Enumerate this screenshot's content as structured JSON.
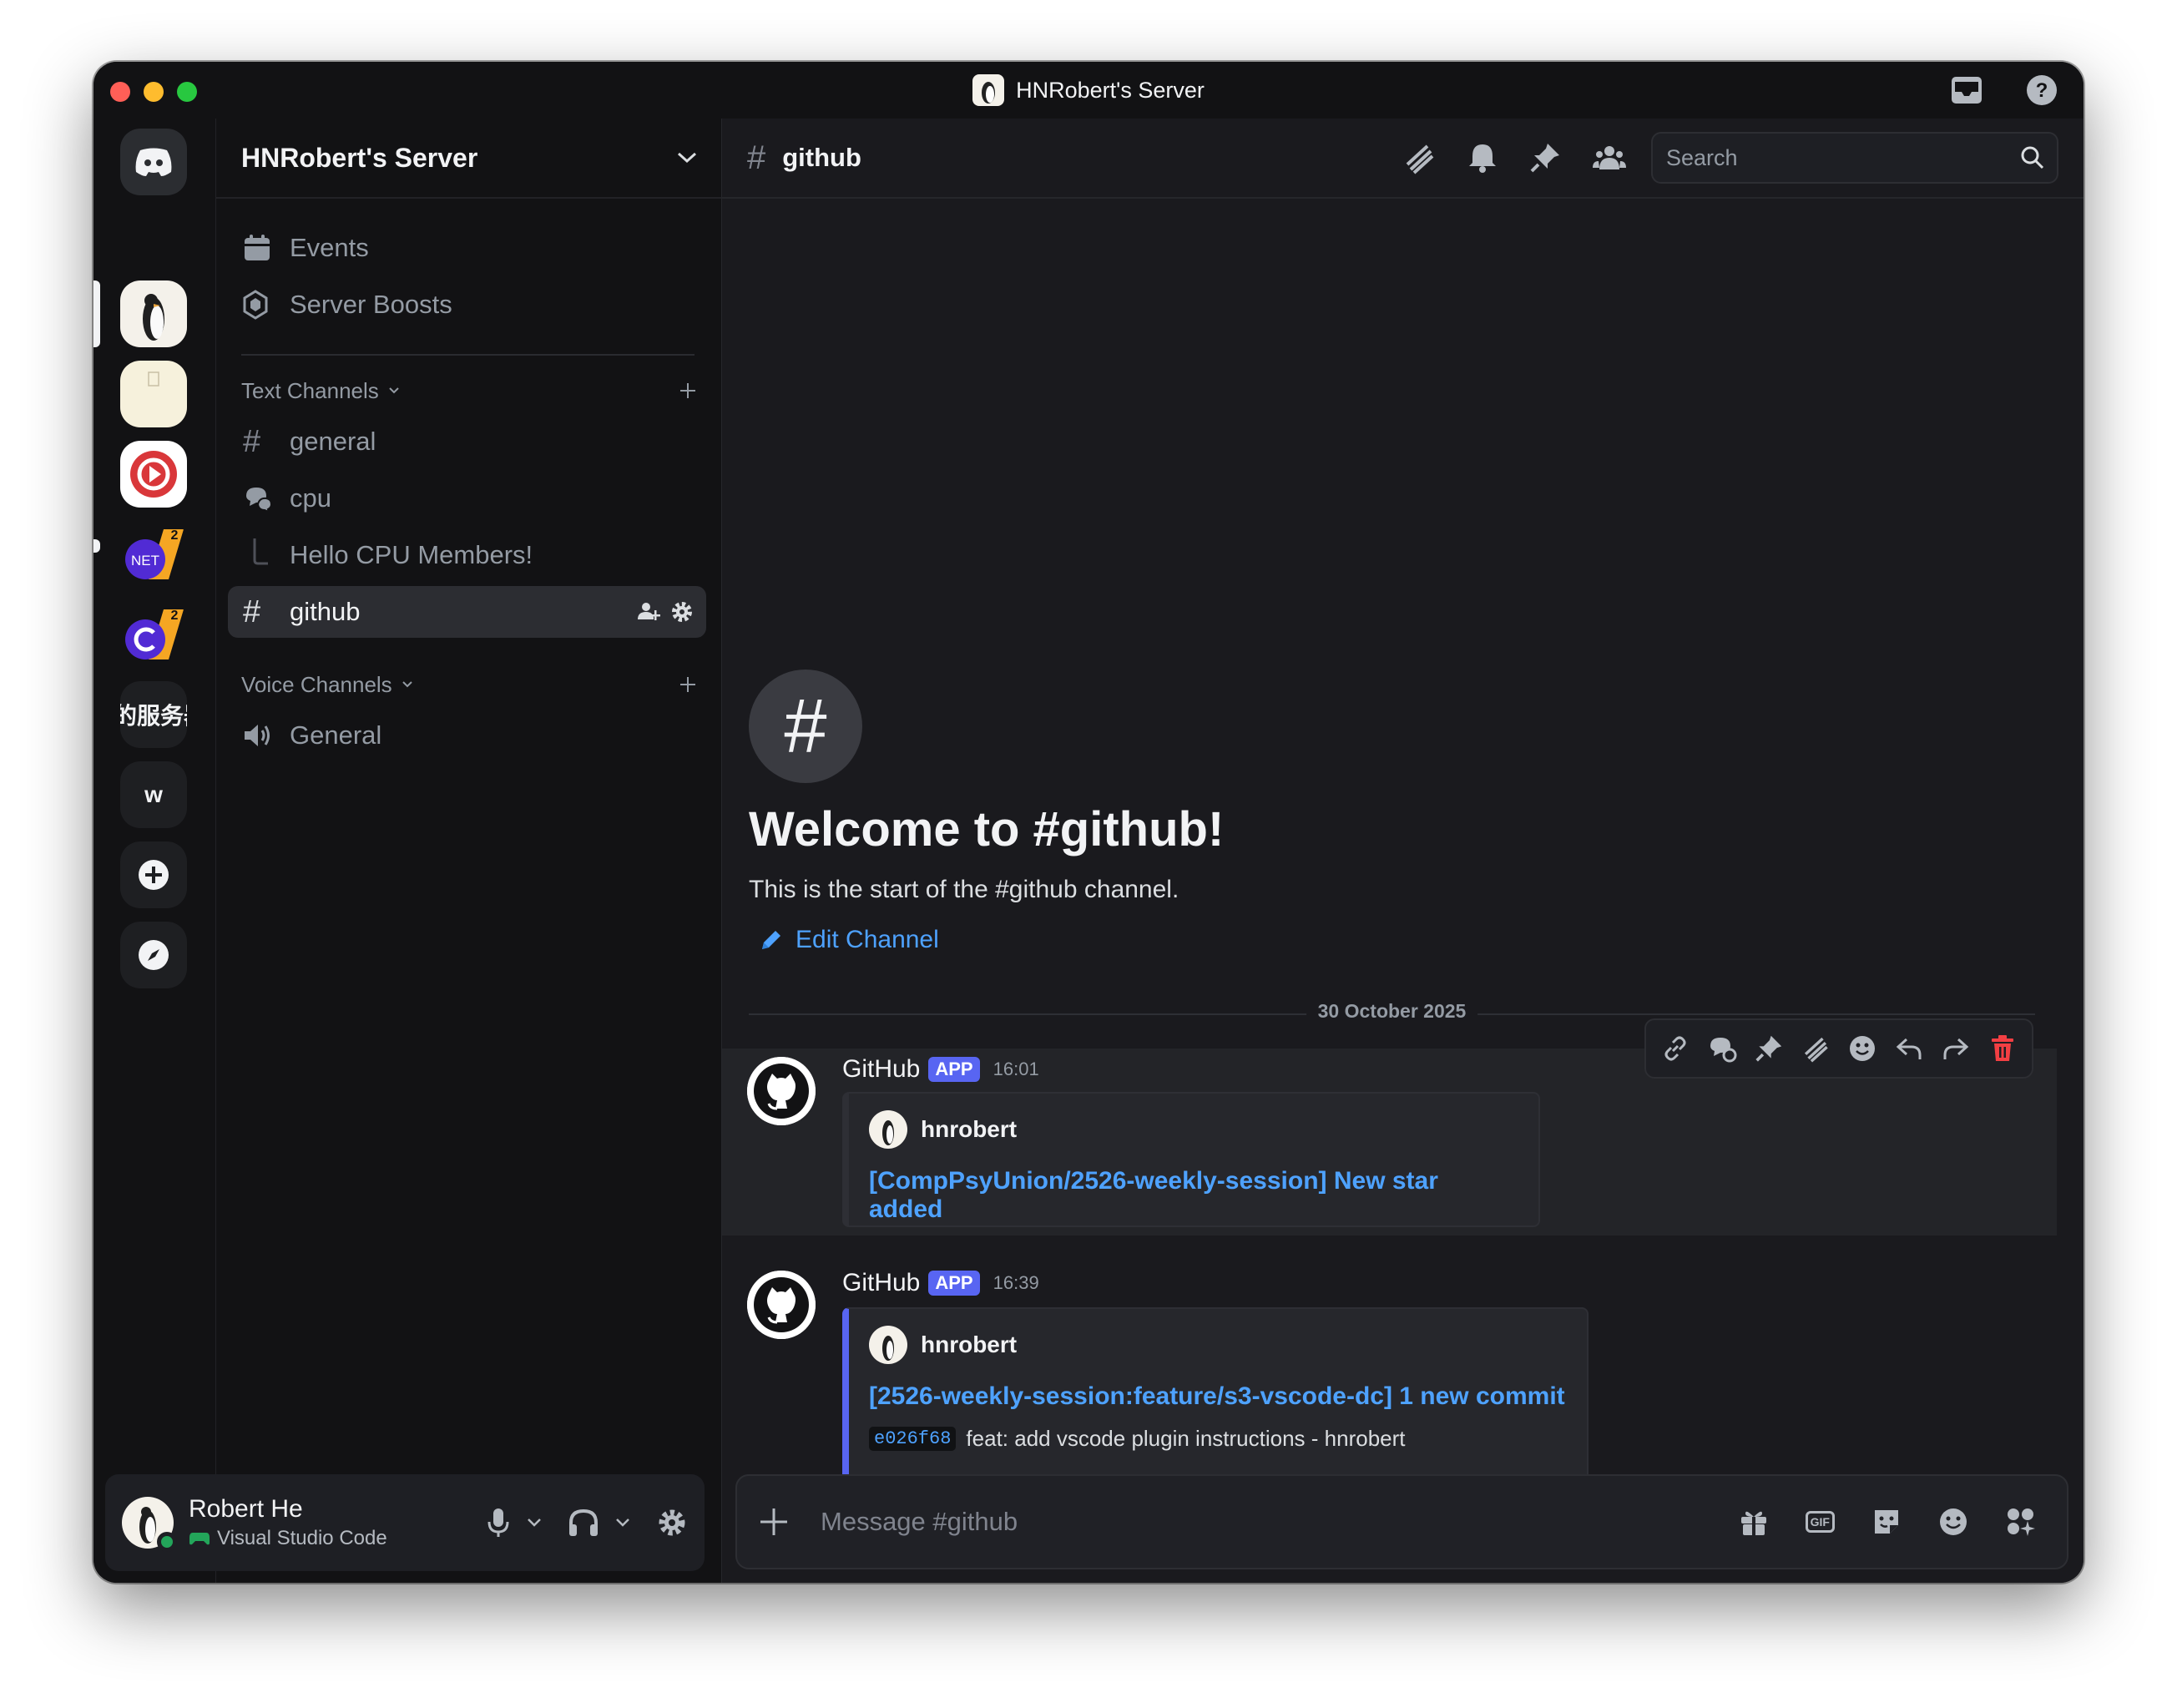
{
  "window": {
    "title": "HNRobert's Server"
  },
  "server": {
    "name": "HNRobert's Server"
  },
  "rail": {
    "cjk_label": "的服务器",
    "w_label": "w",
    "net_label": "NET",
    "badge_count": "2"
  },
  "sidebar": {
    "events": "Events",
    "server_boosts": "Server Boosts",
    "text_channels": "Text Channels",
    "voice_channels": "Voice Channels",
    "channels": {
      "general": "general",
      "cpu": "cpu",
      "cpu_thread": "Hello CPU Members!",
      "github": "github",
      "voice_general": "General"
    }
  },
  "user": {
    "name": "Robert He",
    "activity": "Visual Studio Code"
  },
  "channel": {
    "name": "github",
    "search_placeholder": "Search"
  },
  "welcome": {
    "badge": "#",
    "title": "Welcome to #github!",
    "subtitle": "This is the start of the #github channel.",
    "edit_label": "Edit Channel"
  },
  "date_separator": "30 October 2025",
  "messages": [
    {
      "author": "GitHub",
      "badge": "APP",
      "time": "16:01",
      "embed_author": "hnrobert",
      "embed_title": "[CompPsyUnion/2526-weekly-session] New star added"
    },
    {
      "author": "GitHub",
      "badge": "APP",
      "time": "16:39",
      "embed_author": "hnrobert",
      "embed_title": "[2526-weekly-session:feature/s3-vscode-dc] 1 new commit",
      "commit_hash": "e026f68",
      "commit_message": "feat: add vscode plugin instructions - hnrobert"
    }
  ],
  "composer": {
    "placeholder": "Message #github",
    "gif_label": "GIF"
  },
  "colors": {
    "background": "#1a1a1e",
    "sidebar": "#121214",
    "accent": "#5865f2",
    "link": "#4ea2ff",
    "online": "#23a55a",
    "danger": "#f23f43"
  }
}
